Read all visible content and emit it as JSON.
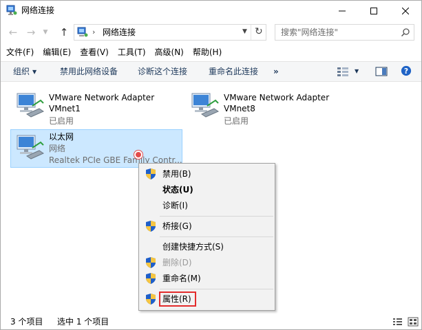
{
  "window": {
    "title": "网络连接"
  },
  "address": {
    "path": "网络连接",
    "search_placeholder": "搜索\"网络连接\""
  },
  "menu": {
    "items": [
      "文件(F)",
      "编辑(E)",
      "查看(V)",
      "工具(T)",
      "高级(N)",
      "帮助(H)"
    ]
  },
  "commands": {
    "organize": "组织",
    "disable": "禁用此网络设备",
    "diagnose": "诊断这个连接",
    "rename": "重命名此连接",
    "more": "»"
  },
  "connections": [
    {
      "name": "VMware Network Adapter",
      "sub": "VMnet1",
      "status": "已启用"
    },
    {
      "name": "VMware Network Adapter",
      "sub": "VMnet8",
      "status": "已启用"
    },
    {
      "name": "以太网",
      "sub": "网络",
      "status": "Realtek PCIe GBE Family Contr..."
    }
  ],
  "context_menu": {
    "items": [
      {
        "label": "禁用(B)",
        "icon": "shield-icon"
      },
      {
        "label": "状态(U)",
        "bold": true
      },
      {
        "label": "诊断(I)"
      },
      {
        "label": "桥接(G)",
        "icon": "shield-icon"
      },
      {
        "label": "创建快捷方式(S)"
      },
      {
        "label": "删除(D)",
        "icon": "shield-icon",
        "disabled": true
      },
      {
        "label": "重命名(M)",
        "icon": "shield-icon"
      },
      {
        "label": "属性(R)",
        "icon": "shield-icon",
        "highlighted": true
      }
    ]
  },
  "status": {
    "count": "3 个项目",
    "selected": "选中 1 个项目"
  },
  "colors": {
    "selection_bg": "#cce8ff",
    "selection_border": "#99d1ff",
    "highlight_red": "#e32b2b",
    "accent_blue": "#1e395b"
  }
}
